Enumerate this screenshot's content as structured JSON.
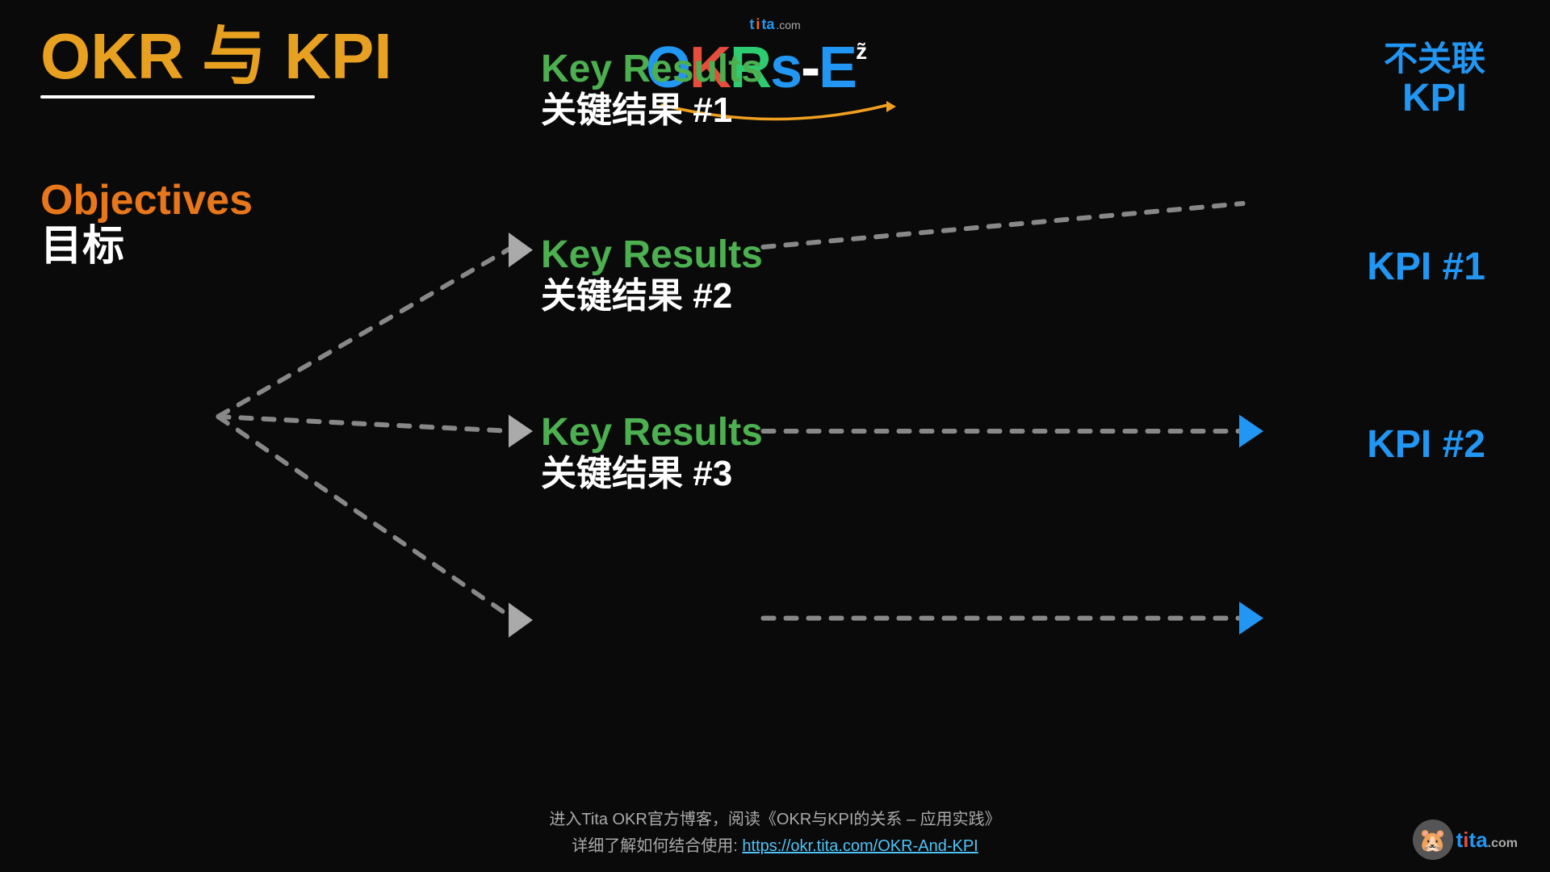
{
  "title": {
    "main": "OKR 与 KPI",
    "underline": true
  },
  "logo": {
    "tita_label": "tita",
    "com_label": ".com",
    "okrs_letters": [
      "O",
      "K",
      "R",
      "s",
      "-",
      "E"
    ],
    "superscript": "z"
  },
  "objectives": {
    "english": "Objectives",
    "chinese": "目标"
  },
  "key_results": [
    {
      "id": "kr1",
      "english": "Key Results",
      "chinese": "关键结果 #1"
    },
    {
      "id": "kr2",
      "english": "Key Results",
      "chinese": "关键结果 #2"
    },
    {
      "id": "kr3",
      "english": "Key Results",
      "chinese": "关键结果 #3"
    }
  ],
  "kpi_labels": {
    "unrelated_line1": "不关联",
    "unrelated_line2": "KPI",
    "kpi1": "KPI #1",
    "kpi2": "KPI #2"
  },
  "footer": {
    "line1": "进入Tita OKR官方博客，阅读《OKR与KPI的关系 – 应用实践》",
    "line2_prefix": "详细了解如何结合使用: ",
    "line2_link": "https://okr.tita.com/OKR-And-KPI",
    "line2_link_text": "https://okr.tita.com/OKR-And-KPI"
  },
  "colors": {
    "background": "#0a0a0a",
    "objectives_color": "#e8761a",
    "key_results_color": "#4CAF50",
    "kpi_color": "#2196F3",
    "white": "#ffffff",
    "dot_color": "#888888",
    "arrow_color": "#aaaaaa"
  }
}
